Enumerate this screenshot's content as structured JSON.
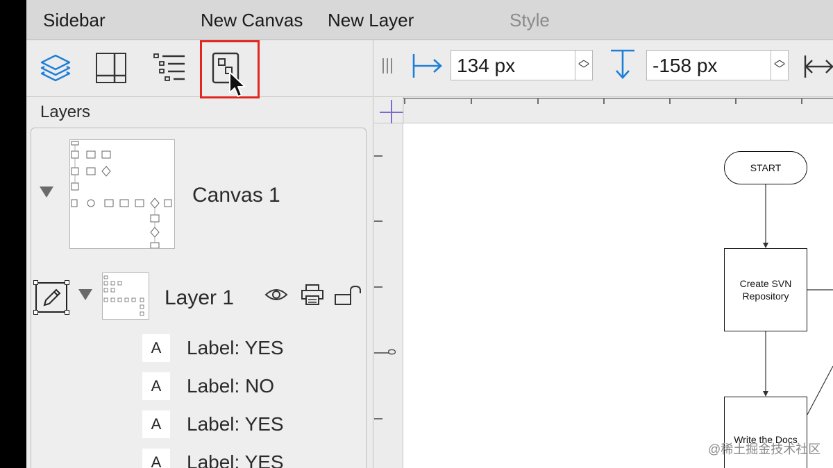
{
  "topbar": {
    "tabs": [
      {
        "label": "Sidebar"
      },
      {
        "label": "New Canvas"
      },
      {
        "label": "New Layer"
      },
      {
        "label": "Style"
      }
    ]
  },
  "sidebar": {
    "toolbar": {
      "icons": [
        "layers-icon",
        "grid-icon",
        "outline-list-icon",
        "canvas-icon"
      ],
      "highlighted_tool": "canvas-icon"
    },
    "layers_title": "Layers",
    "canvas": {
      "name": "Canvas 1"
    },
    "layer": {
      "name": "Layer 1"
    },
    "labels": [
      {
        "icon": "A",
        "text": "Label: YES"
      },
      {
        "icon": "A",
        "text": "Label: NO"
      },
      {
        "icon": "A",
        "text": "Label: YES"
      },
      {
        "icon": "A",
        "text": "Label: YES"
      }
    ]
  },
  "inspector": {
    "x_value": "134 px",
    "y_value": "-158 px"
  },
  "ruler": {
    "vertical_label": "0"
  },
  "canvas": {
    "nodes": {
      "start": "START",
      "create_svn": "Create SVN Repository",
      "write_docs": "Write the Docs"
    }
  },
  "watermark": "@稀土掘金技术社区",
  "colors": {
    "accent_blue": "#1e7fd8",
    "highlight_red": "#e0261e"
  }
}
